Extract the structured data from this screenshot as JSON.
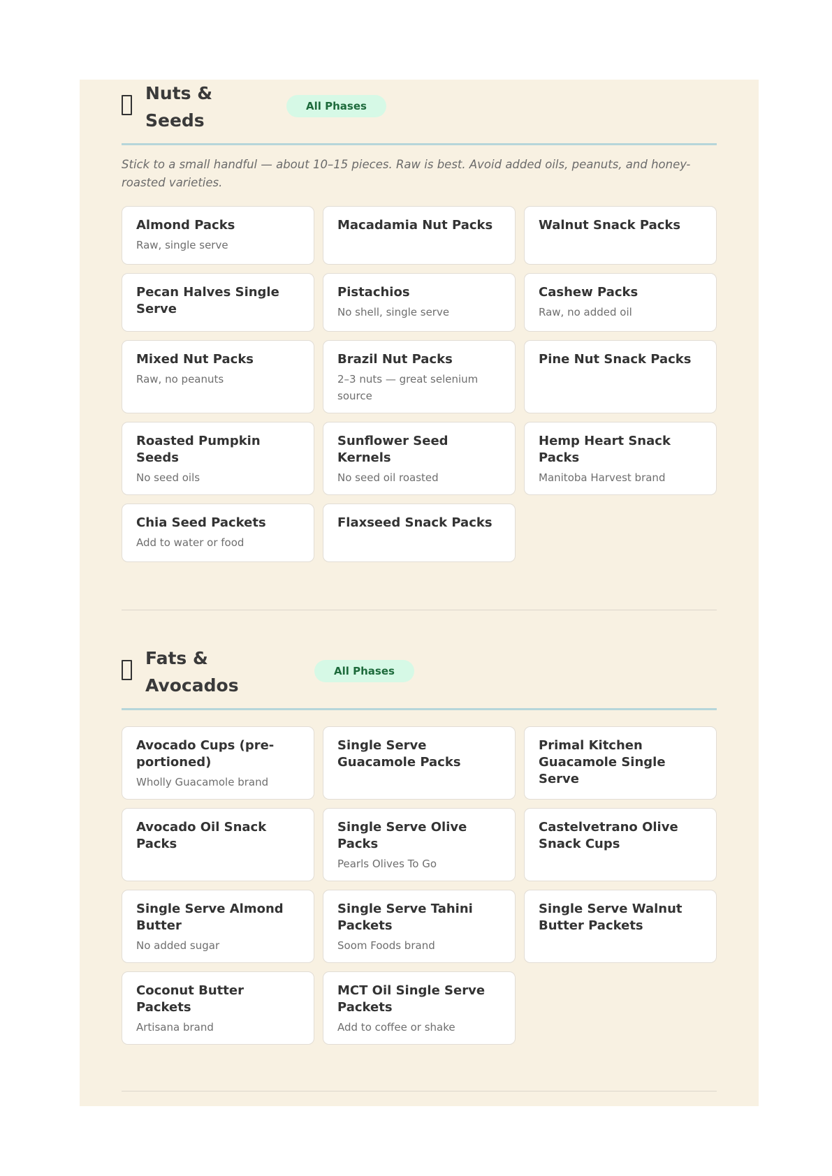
{
  "sections": [
    {
      "title": "Nuts & Seeds",
      "icon": "placeholder-glyph-icon",
      "badge": "All Phases",
      "intro": "Stick to a small handful — about 10–15 pieces. Raw is best. Avoid added oils, peanuts, and honey-roasted varieties.",
      "items": [
        {
          "name": "Almond Packs",
          "note": "Raw, single serve"
        },
        {
          "name": "Macadamia Nut Packs",
          "note": ""
        },
        {
          "name": "Walnut Snack Packs",
          "note": ""
        },
        {
          "name": "Pecan Halves Single Serve",
          "note": ""
        },
        {
          "name": "Pistachios",
          "note": "No shell, single serve"
        },
        {
          "name": "Cashew Packs",
          "note": "Raw, no added oil"
        },
        {
          "name": "Mixed Nut Packs",
          "note": "Raw, no peanuts"
        },
        {
          "name": "Brazil Nut Packs",
          "note": "2–3 nuts — great selenium source"
        },
        {
          "name": "Pine Nut Snack Packs",
          "note": ""
        },
        {
          "name": "Roasted Pumpkin Seeds",
          "note": "No seed oils"
        },
        {
          "name": "Sunflower Seed Kernels",
          "note": "No seed oil roasted"
        },
        {
          "name": "Hemp Heart Snack Packs",
          "note": "Manitoba Harvest brand"
        },
        {
          "name": "Chia Seed Packets",
          "note": "Add to water or food"
        },
        {
          "name": "Flaxseed Snack Packs",
          "note": ""
        }
      ]
    },
    {
      "title": "Fats & Avocados",
      "icon": "placeholder-glyph-icon",
      "badge": "All Phases",
      "intro": "",
      "items": [
        {
          "name": "Avocado Cups (pre-portioned)",
          "note": "Wholly Guacamole brand"
        },
        {
          "name": "Single Serve Guacamole Packs",
          "note": ""
        },
        {
          "name": "Primal Kitchen Guacamole Single Serve",
          "note": ""
        },
        {
          "name": "Avocado Oil Snack Packs",
          "note": ""
        },
        {
          "name": "Single Serve Olive Packs",
          "note": "Pearls Olives To Go"
        },
        {
          "name": "Castelvetrano Olive Snack Cups",
          "note": ""
        },
        {
          "name": "Single Serve Almond Butter",
          "note": "No added sugar"
        },
        {
          "name": "Single Serve Tahini Packets",
          "note": "Soom Foods brand"
        },
        {
          "name": "Single Serve Walnut Butter Packets",
          "note": ""
        },
        {
          "name": "Coconut Butter Packets",
          "note": "Artisana brand"
        },
        {
          "name": "MCT Oil Single Serve Packets",
          "note": "Add to coffee or shake"
        }
      ]
    }
  ]
}
